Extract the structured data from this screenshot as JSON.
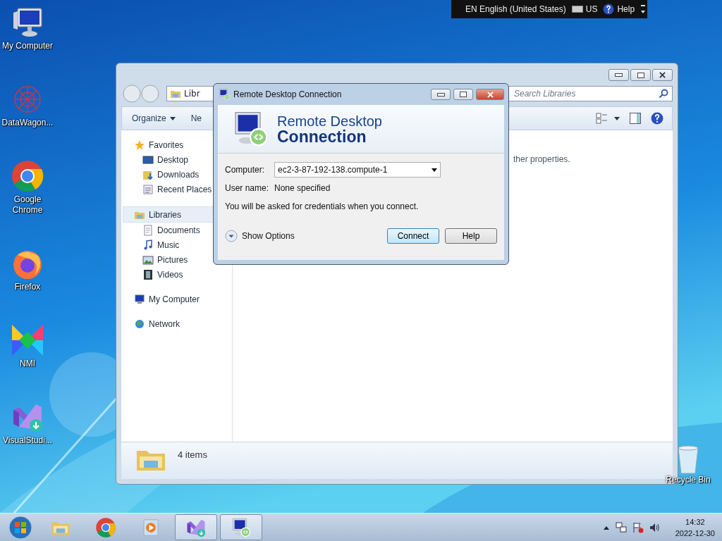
{
  "language_bar": {
    "language": "EN English (United States)",
    "keyboard": "US",
    "help": "Help"
  },
  "desktop_icons": [
    {
      "label": "My Computer",
      "kind": "computer"
    },
    {
      "label": "DataWagon...",
      "kind": "web"
    },
    {
      "label": "Google Chrome",
      "kind": "chrome"
    },
    {
      "label": "Firefox",
      "kind": "firefox"
    },
    {
      "label": "NMI",
      "kind": "nmi"
    },
    {
      "label": "VisualStudi...",
      "kind": "vs"
    }
  ],
  "recycle_bin": {
    "label": "Recycle Bin"
  },
  "explorer": {
    "breadcrumb": "Libr",
    "search_placeholder": "Search Libraries",
    "toolbar": [
      "Organize",
      "Ne"
    ],
    "nav": [
      {
        "label": "Favorites",
        "kind": "star",
        "children": [
          {
            "label": "Desktop",
            "kind": "desktop"
          },
          {
            "label": "Downloads",
            "kind": "downloads"
          },
          {
            "label": "Recent Places",
            "kind": "recent"
          }
        ]
      },
      {
        "label": "Libraries",
        "kind": "library",
        "selected": true,
        "children": [
          {
            "label": "Documents",
            "kind": "doc"
          },
          {
            "label": "Music",
            "kind": "music"
          },
          {
            "label": "Pictures",
            "kind": "pictures"
          },
          {
            "label": "Videos",
            "kind": "videos"
          }
        ]
      },
      {
        "label": "My Computer",
        "kind": "computer",
        "selected": false
      },
      {
        "label": "Network",
        "kind": "network",
        "selected": false
      }
    ],
    "content_text": "ther properties.",
    "status": "4 items"
  },
  "dialog": {
    "title": "Remote Desktop Connection",
    "heading_1": "Remote Desktop",
    "heading_2": "Connection",
    "computer_label": "Computer:",
    "computer_value": "ec2-3-87-192-138.compute-1",
    "user_label": "User name:",
    "user_value": "None specified",
    "note": "You will be asked for credentials when you connect.",
    "show_options": "Show Options",
    "buttons": [
      {
        "label": "Connect",
        "selected": true
      },
      {
        "label": "Help",
        "selected": false
      }
    ]
  },
  "taskbar": {
    "items": [
      {
        "kind": "explorer",
        "selected": false
      },
      {
        "kind": "chrome",
        "selected": false
      },
      {
        "kind": "media",
        "selected": false
      },
      {
        "kind": "vs",
        "selected": true
      },
      {
        "kind": "rdc",
        "selected": true
      }
    ],
    "time": "14:32",
    "date": "2022-12-30"
  }
}
